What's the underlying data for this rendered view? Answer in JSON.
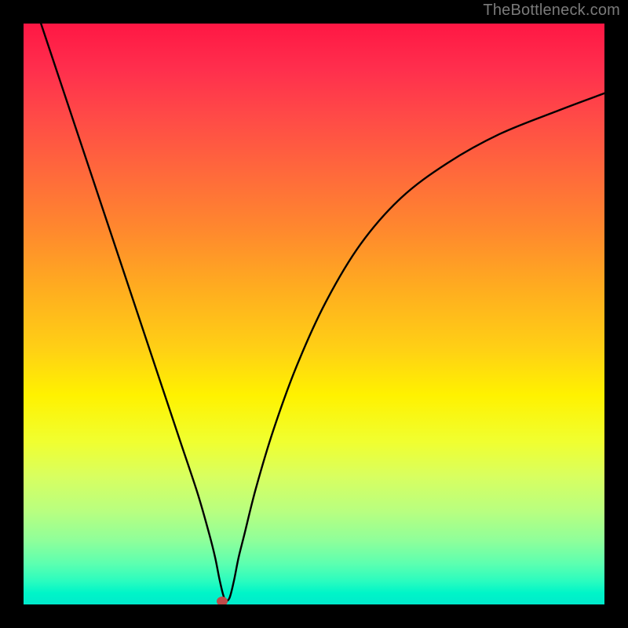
{
  "watermark": "TheBottleneck.com",
  "chart_data": {
    "type": "line",
    "title": "",
    "xlabel": "",
    "ylabel": "",
    "xlim": [
      0,
      100
    ],
    "ylim": [
      0,
      100
    ],
    "grid": false,
    "annotations": [],
    "series": [
      {
        "name": "curve",
        "color": "#000000",
        "x": [
          3,
          6,
          9,
          12,
          15,
          18,
          21,
          24,
          27,
          30,
          32,
          33,
          33.8,
          34.6,
          35.4,
          36.2,
          37,
          38,
          40,
          43,
          47,
          52,
          58,
          65,
          73,
          82,
          92,
          100
        ],
        "values": [
          100,
          91,
          82,
          73,
          64,
          55,
          46,
          37,
          28,
          19,
          12,
          8,
          4,
          1,
          1,
          4,
          8,
          12,
          20,
          30,
          41,
          52,
          62,
          70,
          76,
          81,
          85,
          88
        ]
      }
    ],
    "marker": {
      "x": 34.2,
      "y": 0.5,
      "color": "#c04a4a"
    },
    "legend": null
  }
}
